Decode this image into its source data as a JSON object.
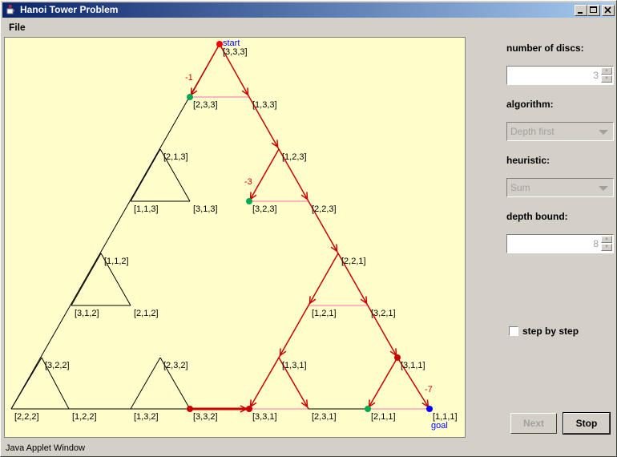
{
  "window": {
    "title": "Hanoi Tower Problem"
  },
  "menu": {
    "file": "File"
  },
  "status": "Java Applet Window",
  "panel": {
    "num_discs_label": "number of discs:",
    "num_discs_value": "3",
    "algorithm_label": "algorithm:",
    "algorithm_value": "Depth first",
    "heuristic_label": "heuristic:",
    "heuristic_value": "Sum",
    "depth_label": "depth bound:",
    "depth_value": "8",
    "step_label": "step by step",
    "next_label": "Next",
    "stop_label": "Stop"
  },
  "graph": {
    "start_label": "start",
    "goal_label": "goal",
    "nodes": [
      {
        "id": "333",
        "label": "[3,3,3]"
      },
      {
        "id": "233",
        "label": "[2,3,3]"
      },
      {
        "id": "133",
        "label": "[1,3,3]"
      },
      {
        "id": "213",
        "label": "[2,1,3]"
      },
      {
        "id": "123",
        "label": "[1,2,3]"
      },
      {
        "id": "113",
        "label": "[1,1,3]"
      },
      {
        "id": "313",
        "label": "[3,1,3]"
      },
      {
        "id": "323",
        "label": "[3,2,3]"
      },
      {
        "id": "223",
        "label": "[2,2,3]"
      },
      {
        "id": "112",
        "label": "[1,1,2]"
      },
      {
        "id": "221",
        "label": "[2,2,1]"
      },
      {
        "id": "312",
        "label": "[3,1,2]"
      },
      {
        "id": "212",
        "label": "[2,1,2]"
      },
      {
        "id": "121",
        "label": "[1,2,1]"
      },
      {
        "id": "321",
        "label": "[3,2,1]"
      },
      {
        "id": "322",
        "label": "[3,2,2]"
      },
      {
        "id": "232",
        "label": "[2,3,2]"
      },
      {
        "id": "131",
        "label": "[1,3,1]"
      },
      {
        "id": "311",
        "label": "[3,1,1]"
      },
      {
        "id": "222",
        "label": "[2,2,2]"
      },
      {
        "id": "122",
        "label": "[1,2,2]"
      },
      {
        "id": "132",
        "label": "[1,3,2]"
      },
      {
        "id": "332",
        "label": "[3,3,2]"
      },
      {
        "id": "331",
        "label": "[3,3,1]"
      },
      {
        "id": "231",
        "label": "[2,3,1]"
      },
      {
        "id": "211",
        "label": "[2,1,1]"
      },
      {
        "id": "111",
        "label": "[1,1,1]"
      }
    ],
    "costs": [
      {
        "at": "233",
        "label": "-1"
      },
      {
        "at": "323",
        "label": "-3"
      },
      {
        "at": "111",
        "label": "-7"
      }
    ]
  },
  "colors": {
    "canvas_bg": "#ffffcc",
    "path": "#cc0000",
    "branch": "#ffb6c1",
    "start": "#ff0000",
    "goal": "#0000ff",
    "open": "#00aa55"
  }
}
